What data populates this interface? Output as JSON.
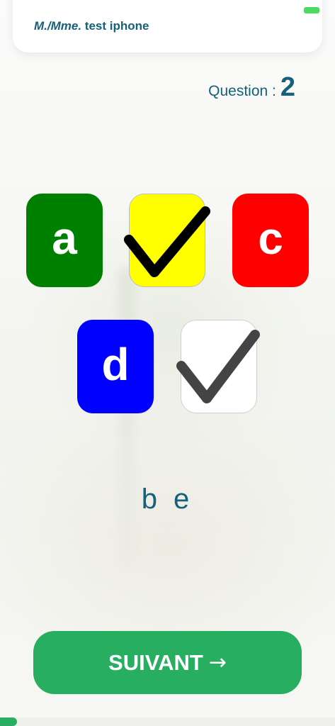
{
  "header": {
    "salutation": "M./Mme.",
    "user": "test iphone"
  },
  "question": {
    "label": "Question :",
    "number": "2"
  },
  "tiles": [
    {
      "id": "a",
      "letter": "a",
      "color": "#008000",
      "checked": false
    },
    {
      "id": "b",
      "letter": "",
      "color": "#ffff00",
      "checked": true,
      "check_color": "#000000"
    },
    {
      "id": "c",
      "letter": "c",
      "color": "#ff0000",
      "checked": false
    },
    {
      "id": "d",
      "letter": "d",
      "color": "#0000ff",
      "checked": false
    },
    {
      "id": "e",
      "letter": "",
      "color": "#ffffff",
      "checked": true,
      "check_color": "#444444"
    }
  ],
  "answer": {
    "text": "b e"
  },
  "next_button": {
    "label": "SUIVANT",
    "icon": "arrow-right-icon",
    "color": "#27ae60"
  },
  "progress": {
    "fraction": 0.05
  },
  "colors": {
    "text_primary": "#15607a",
    "battery": "#4cd964"
  }
}
